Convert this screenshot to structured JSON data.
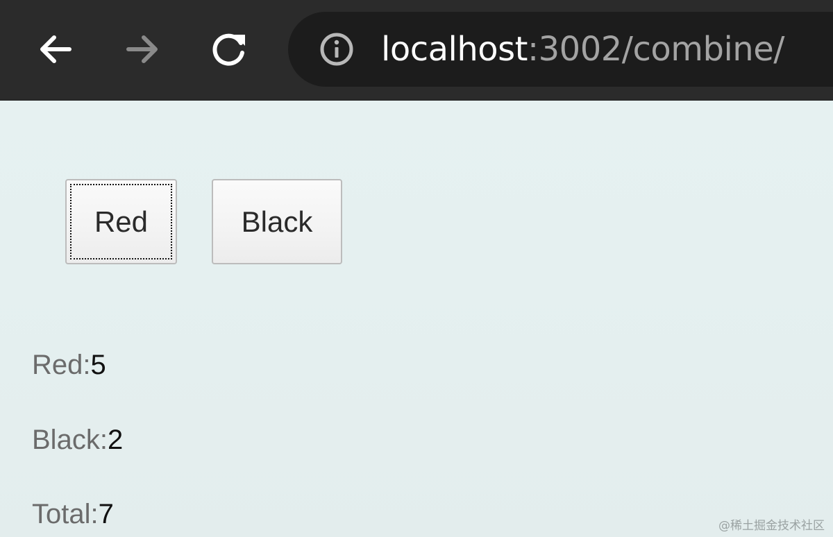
{
  "browser": {
    "url_host": "localhost",
    "url_rest": ":3002/combine/"
  },
  "icons": {
    "back": "arrow-left-icon",
    "forward": "arrow-right-icon",
    "reload": "reload-icon",
    "site_info": "info-icon"
  },
  "buttons": {
    "red_label": "Red",
    "black_label": "Black"
  },
  "stats": {
    "red_label": "Red:",
    "red_value": "5",
    "black_label": "Black:",
    "black_value": "2",
    "total_label": "Total:",
    "total_value": "7"
  },
  "watermark": "@稀土掘金技术社区",
  "colors": {
    "toolbar_bg": "#2b2b2b",
    "omnibox_bg": "#1c1c1c",
    "page_bg": "#e5f0f0"
  }
}
